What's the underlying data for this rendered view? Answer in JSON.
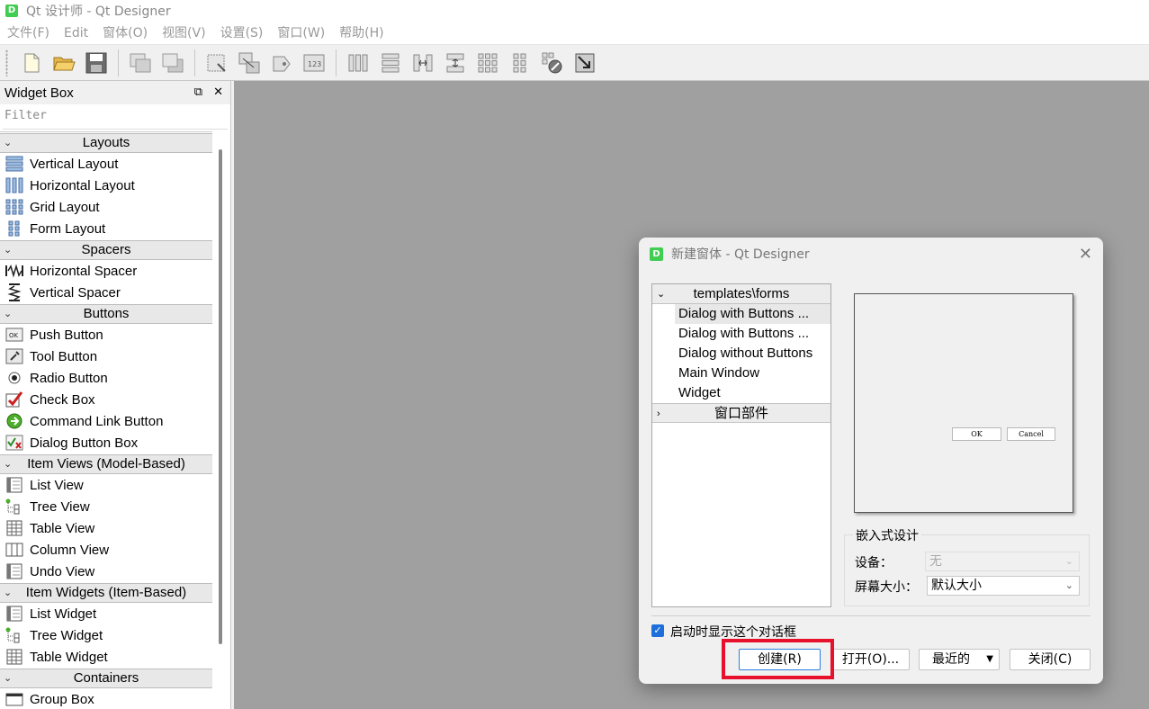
{
  "window": {
    "title": "Qt 设计师 - Qt Designer",
    "icon_letter": "D"
  },
  "menu": [
    "文件(F)",
    "Edit",
    "窗体(O)",
    "视图(V)",
    "设置(S)",
    "窗口(W)",
    "帮助(H)"
  ],
  "widget_box": {
    "title": "Widget Box",
    "filter_placeholder": "Filter",
    "sections": [
      {
        "name": "Layouts",
        "items": [
          "Vertical Layout",
          "Horizontal Layout",
          "Grid Layout",
          "Form Layout"
        ]
      },
      {
        "name": "Spacers",
        "items": [
          "Horizontal Spacer",
          "Vertical Spacer"
        ]
      },
      {
        "name": "Buttons",
        "items": [
          "Push Button",
          "Tool Button",
          "Radio Button",
          "Check Box",
          "Command Link Button",
          "Dialog Button Box"
        ]
      },
      {
        "name": "Item Views (Model-Based)",
        "items": [
          "List View",
          "Tree View",
          "Table View",
          "Column View",
          "Undo View"
        ]
      },
      {
        "name": "Item Widgets (Item-Based)",
        "items": [
          "List Widget",
          "Tree Widget",
          "Table Widget"
        ]
      },
      {
        "name": "Containers",
        "items": [
          "Group Box"
        ]
      }
    ]
  },
  "dialog": {
    "title": "新建窗体 - Qt Designer",
    "icon_letter": "D",
    "tree": {
      "category": "templates\\forms",
      "items": [
        "Dialog with Buttons ...",
        "Dialog with Buttons ...",
        "Dialog without Buttons",
        "Main Window",
        "Widget"
      ],
      "category2": "窗口部件"
    },
    "preview": {
      "ok": "OK",
      "cancel": "Cancel"
    },
    "embedded": {
      "title": "嵌入式设计",
      "device_label": "设备：",
      "device_value": "无",
      "screen_label": "屏幕大小：",
      "screen_value": "默认大小"
    },
    "show_on_startup": "启动时显示这个对话框",
    "buttons": {
      "create": "创建(R)",
      "open": "打开(O)...",
      "recent": "最近的",
      "close": "关闭(C)"
    }
  }
}
